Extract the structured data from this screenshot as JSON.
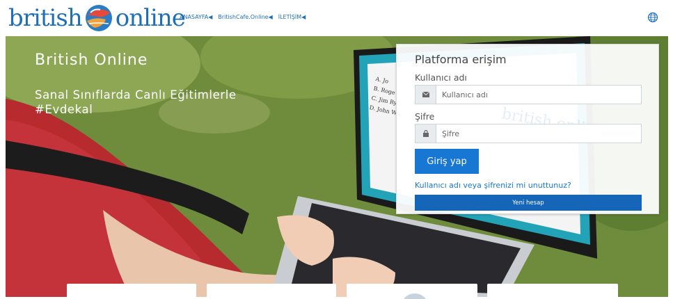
{
  "header": {
    "logo": {
      "word1": "british",
      "word2": "online"
    },
    "nav": [
      {
        "label": "ANASAYFA◀"
      },
      {
        "label": "BritishCafe.Online◀"
      },
      {
        "label": "İLETİŞİM◀"
      }
    ],
    "language_icon": "globe-icon"
  },
  "hero": {
    "title": "British Online",
    "subtitle_line1": "Sanal Sınıflarda Canlı Eğitimlerle",
    "subtitle_line2": "#Evdekal",
    "laptop_screen_lines": [
      "A. Jo",
      "B. Roge",
      "C. Jim Ry",
      "D. John Wa"
    ],
    "watermark": "british online"
  },
  "login": {
    "title": "Platforma erişim",
    "username_label": "Kullanıcı adı",
    "username_placeholder": "Kullanıcı adı",
    "username_icon": "envelope-icon",
    "password_label": "Şifre",
    "password_placeholder": "Şifre",
    "password_icon": "lock-icon",
    "submit_label": "Giriş yap",
    "forgot_label": "Kullanıcı adı veya şifrenizi mi unuttunuz?",
    "new_account_label": "Yeni hesap"
  },
  "colors": {
    "brand_blue": "#1e6fb8",
    "button_blue": "#1877d2",
    "new_account_blue": "#1565b8"
  }
}
